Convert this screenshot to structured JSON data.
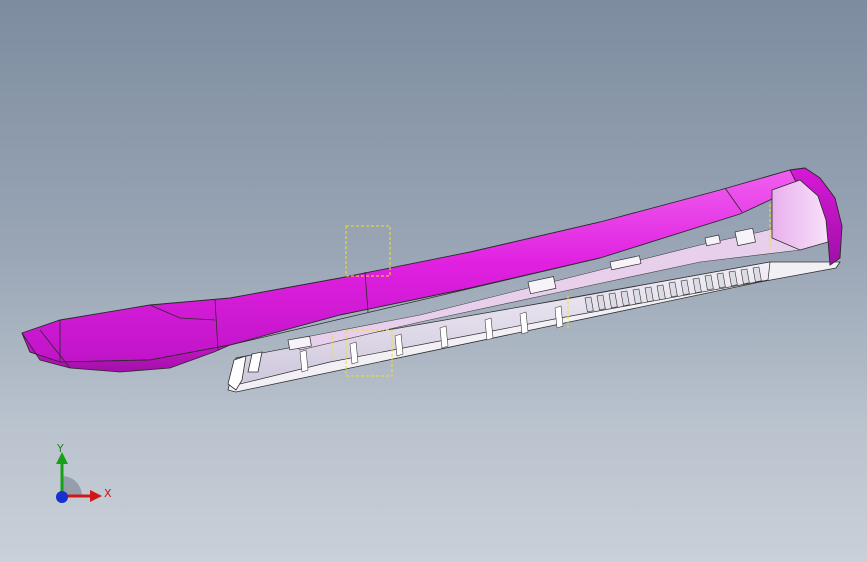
{
  "viewport": {
    "background_top": "#7d8ca0",
    "background_bottom": "#c9d0d9"
  },
  "model": {
    "body_color": "#e020e0",
    "body_shade": "#b010b4",
    "edge_color": "#2a2a2a",
    "insert_color": "#e8e4f0",
    "selection_color": "#f0e020"
  },
  "triad": {
    "x_label": "X",
    "y_label": "Y",
    "x_color": "#d01818",
    "y_color": "#18a018",
    "z_color": "#1830d0"
  }
}
